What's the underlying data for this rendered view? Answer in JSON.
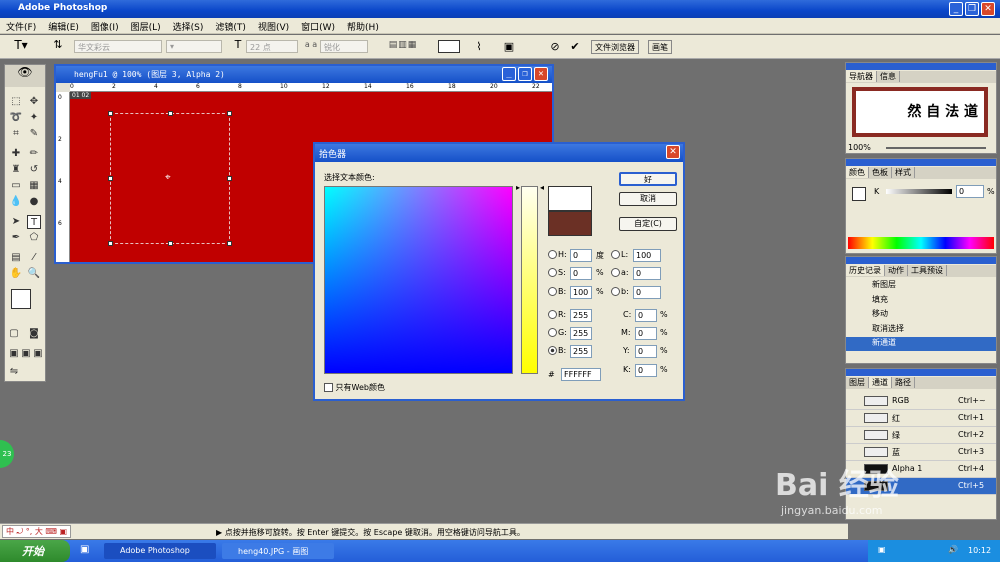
{
  "app": {
    "title": "Adobe Photoshop"
  },
  "menu": [
    "文件(F)",
    "编辑(E)",
    "图像(I)",
    "图层(L)",
    "选择(S)",
    "滤镜(T)",
    "视图(V)",
    "窗口(W)",
    "帮助(H)"
  ],
  "options": {
    "font_family": "华文彩云",
    "font_size": "22 点",
    "anti_alias": "锐化",
    "aa_glyph": "a a",
    "tabs": [
      "文件浏览器",
      "画笔"
    ]
  },
  "document": {
    "title": "hengFu1 @ 100% (图层 3, Alpha 2)",
    "ruler_top": [
      "0",
      "2",
      "4",
      "6",
      "8",
      "10",
      "12",
      "14",
      "16",
      "18",
      "20",
      "22"
    ],
    "ruler_left": [
      "0",
      "2",
      "4",
      "6"
    ],
    "tag": "01 02"
  },
  "dialog": {
    "title": "拾色器",
    "prompt": "选择文本颜色:",
    "ok": "好",
    "cancel": "取消",
    "custom": "自定(C)",
    "web_only": "只有Web颜色",
    "fields": {
      "H": "0",
      "H_unit": "度",
      "S": "0",
      "S_unit": "%",
      "B": "100",
      "B_unit": "%",
      "L": "100",
      "a": "0",
      "b": "0",
      "R": "255",
      "G": "255",
      "Bv": "255",
      "C": "0",
      "M": "0",
      "Y": "0",
      "K": "0",
      "pct": "%"
    },
    "hex_label": "#",
    "hex": "FFFFFF",
    "colors": {
      "new": "#ffffff",
      "current": "#6b3025"
    }
  },
  "navigator": {
    "tabs": [
      "导航器",
      "信息"
    ],
    "preview_text": "然 自 法 道",
    "zoom": "100%"
  },
  "colorpanel": {
    "tabs": [
      "颜色",
      "色板",
      "样式"
    ],
    "k_label": "K",
    "k_value": "0",
    "k_unit": "%"
  },
  "history": {
    "tabs": [
      "历史记录",
      "动作",
      "工具预设"
    ],
    "items": [
      "新图层",
      "填充",
      "移动",
      "取消选择",
      "新通道"
    ]
  },
  "channels": {
    "tabs": [
      "图层",
      "通道",
      "路径"
    ],
    "items": [
      {
        "name": "RGB",
        "key": "Ctrl+~"
      },
      {
        "name": "红",
        "key": "Ctrl+1"
      },
      {
        "name": "绿",
        "key": "Ctrl+2"
      },
      {
        "name": "蓝",
        "key": "Ctrl+3"
      },
      {
        "name": "Alpha 1",
        "key": "Ctrl+4"
      },
      {
        "name": "",
        "key": "Ctrl+5"
      }
    ]
  },
  "status": {
    "text": "▶ 点按并拖移可旋转。按 Enter 键提交。按 Escape 键取消。用空格键访问导航工具。",
    "ime": "中 ⤾ °, 大 ⌨ ▣",
    "badge": "23"
  },
  "taskbar": {
    "start": "开始",
    "tasks": [
      "Adobe Photoshop",
      "heng40.JPG - 画图"
    ],
    "clock": "10:12"
  },
  "watermark": {
    "brand": "Bai 经验",
    "url": "jingyan.baidu.com"
  }
}
